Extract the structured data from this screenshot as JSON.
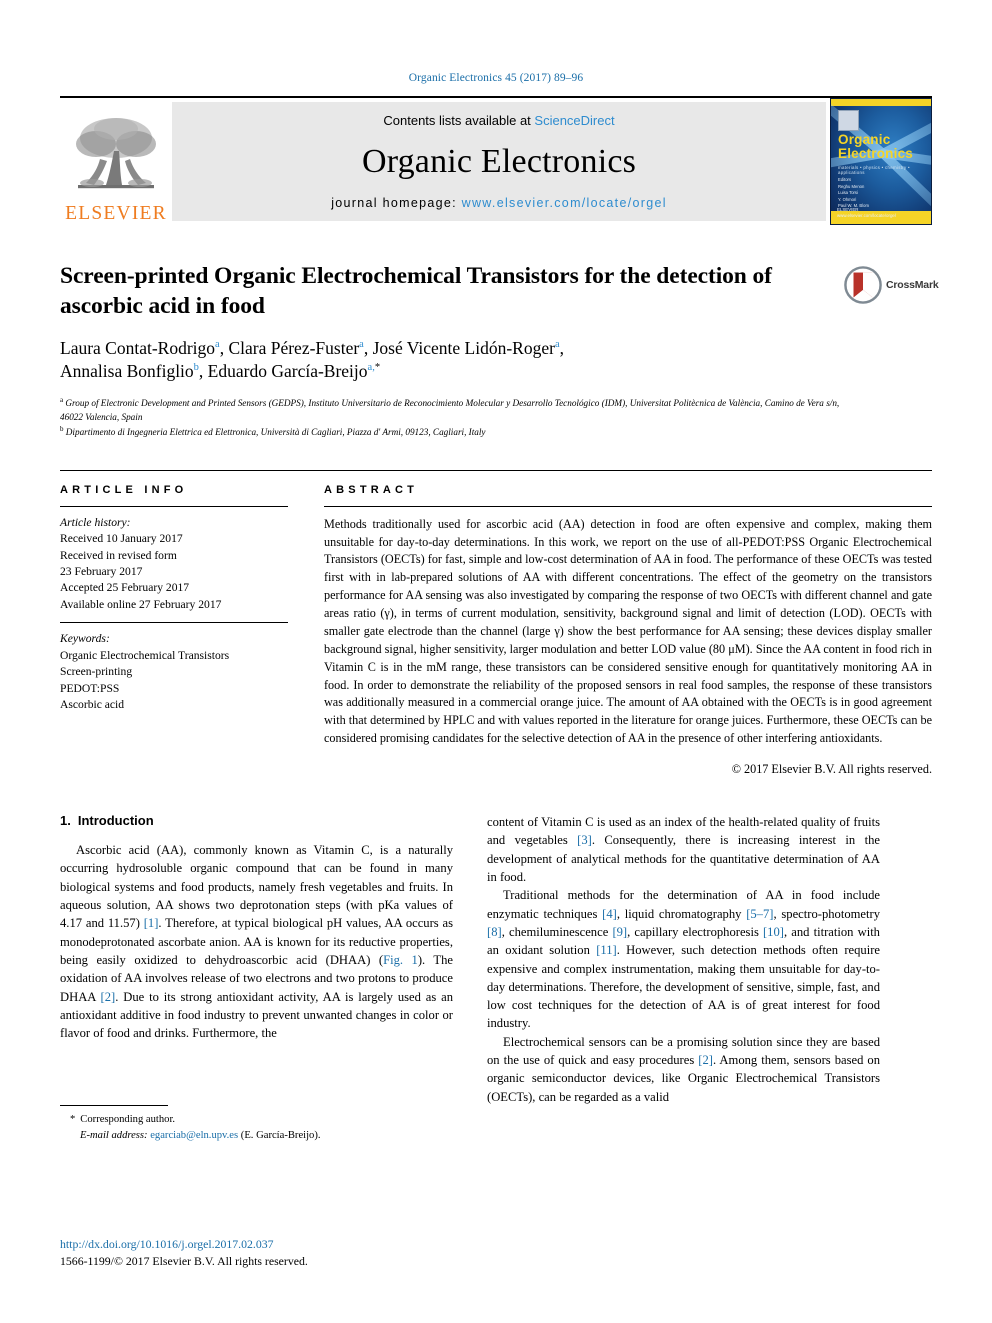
{
  "running_head": "Organic Electronics 45 (2017) 89–96",
  "masthead": {
    "publisher_logo_label": "ELSEVIER",
    "contents_prefix": "Contents lists available at ",
    "contents_link": "ScienceDirect",
    "journal_name": "Organic Electronics",
    "homepage_prefix": "journal homepage: ",
    "homepage_url": "www.elsevier.com/locate/orgel",
    "cover": {
      "title_line1": "Organic",
      "title_line2": "Electronics",
      "subtitle": "materials • physics • chemistry • applications",
      "editors_label": "Editors",
      "editors": "Reghu Menon\nLuisa Torsi\nY. Ohmori\nPaul W. M. Blom\nGeorg Heinz",
      "footer": "ELSEVIER\nwww.elsevier.com/locate/orgel"
    }
  },
  "article": {
    "title": "Screen-printed Organic Electrochemical Transistors for the detection of ascorbic acid in food",
    "authors_line1_parts": [
      {
        "name": "Laura Contat-Rodrigo",
        "sup": "a"
      },
      {
        "name": "Clara Pérez-Fuster",
        "sup": "a"
      },
      {
        "name": "José Vicente Lidón-Roger",
        "sup": "a"
      }
    ],
    "authors_line2_parts": [
      {
        "name": "Annalisa Bonfiglio",
        "sup": "b"
      },
      {
        "name": "Eduardo García-Breijo",
        "sup": "a,",
        "star": "*"
      }
    ],
    "affiliation_a_sup": "a",
    "affiliation_a": "Group of Electronic Development and Printed Sensors (GEDPS), Instituto Universitario de Reconocimiento Molecular y Desarrollo Tecnológico (IDM), Universitat Politècnica de València, Camino de Vera s/n, 46022 Valencia, Spain",
    "affiliation_b_sup": "b",
    "affiliation_b": "Dipartimento di Ingegneria Elettrica ed Elettronica, Università di Cagliari, Piazza d' Armi, 09123, Cagliari, Italy",
    "crossmark_label": "CrossMark"
  },
  "article_info": {
    "heading": "ARTICLE INFO",
    "history_label": "Article history:",
    "history": [
      "Received 10 January 2017",
      "Received in revised form",
      "23 February 2017",
      "Accepted 25 February 2017",
      "Available online 27 February 2017"
    ],
    "keywords_label": "Keywords:",
    "keywords": [
      "Organic Electrochemical Transistors",
      "Screen-printing",
      "PEDOT:PSS",
      "Ascorbic acid"
    ]
  },
  "abstract": {
    "heading": "ABSTRACT",
    "text": "Methods traditionally used for ascorbic acid (AA) detection in food are often expensive and complex, making them unsuitable for day-to-day determinations. In this work, we report on the use of all-PEDOT:PSS Organic Electrochemical Transistors (OECTs) for fast, simple and low-cost determination of AA in food. The performance of these OECTs was tested first with in lab-prepared solutions of AA with different concentrations. The effect of the geometry on the transistors performance for AA sensing was also investigated by comparing the response of two OECTs with different channel and gate areas ratio (γ), in terms of current modulation, sensitivity, background signal and limit of detection (LOD). OECTs with smaller gate electrode than the channel (large γ) show the best performance for AA sensing; these devices display smaller background signal, higher sensitivity, larger modulation and better LOD value (80 μM). Since the AA content in food rich in Vitamin C is in the mM range, these transistors can be considered sensitive enough for quantitatively monitoring AA in food. In order to demonstrate the reliability of the proposed sensors in real food samples, the response of these transistors was additionally measured in a commercial orange juice. The amount of AA obtained with the OECTs is in good agreement with that determined by HPLC and with values reported in the literature for orange juices. Furthermore, these OECTs can be considered promising candidates for the selective detection of AA in the presence of other interfering antioxidants.",
    "copyright": "© 2017 Elsevier B.V. All rights reserved."
  },
  "introduction": {
    "number": "1.",
    "heading": "Introduction",
    "left_p1_a": "Ascorbic acid (AA), commonly known as Vitamin C, is a naturally occurring hydrosoluble organic compound that can be found in many biological systems and food products, namely fresh vegetables and fruits. In aqueous solution, AA shows two deprotonation steps (with pKa values of 4.17 and 11.57) ",
    "left_p1_ref1": "[1]",
    "left_p1_b": ". Therefore, at typical biological pH values, AA occurs as monodeprotonated ascorbate anion. AA is known for its reductive properties, being easily oxidized to dehydroascorbic acid (DHAA) (",
    "left_p1_fig": "Fig. 1",
    "left_p1_c": "). The oxidation of AA involves release of two electrons and two protons to produce DHAA ",
    "left_p1_ref2": "[2]",
    "left_p1_d": ". Due to its strong antioxidant activity, AA is largely used as an antioxidant additive in food industry to prevent unwanted changes in color or flavor of food and drinks. Furthermore, the",
    "right_p1_a": "content of Vitamin C is used as an index of the health-related quality of fruits and vegetables ",
    "right_p1_ref3": "[3]",
    "right_p1_b": ". Consequently, there is increasing interest in the development of analytical methods for the quantitative determination of AA in food.",
    "right_p2_a": "Traditional methods for the determination of AA in food include enzymatic techniques ",
    "right_p2_ref4": "[4]",
    "right_p2_b": ", liquid chromatography ",
    "right_p2_ref57": "[5–7]",
    "right_p2_c": ", spectro-photometry ",
    "right_p2_ref8": "[8]",
    "right_p2_d": ", chemiluminescence ",
    "right_p2_ref9": "[9]",
    "right_p2_e": ", capillary electrophoresis ",
    "right_p2_ref10": "[10]",
    "right_p2_f": ", and titration with an oxidant solution ",
    "right_p2_ref11": "[11]",
    "right_p2_g": ". However, such detection methods often require expensive and complex instrumentation, making them unsuitable for day-to-day determinations. Therefore, the development of sensitive, simple, fast, and low cost techniques for the detection of AA is of great interest for food industry.",
    "right_p3_a": "Electrochemical sensors can be a promising solution since they are based on the use of quick and easy procedures ",
    "right_p3_ref2": "[2]",
    "right_p3_b": ". Among them, sensors based on organic semiconductor devices, like Organic Electrochemical Transistors (OECTs), can be regarded as a valid"
  },
  "footnote": {
    "star": "*",
    "corresponding": "Corresponding author.",
    "email_label": "E-mail address:",
    "email": "egarciab@eln.upv.es",
    "email_owner": "(E. García-Breijo)."
  },
  "page_footer": {
    "doi": "http://dx.doi.org/10.1016/j.orgel.2017.02.037",
    "issn_copyright": "1566-1199/© 2017 Elsevier B.V. All rights reserved."
  },
  "colors": {
    "link_blue": "#1a6ea8",
    "science_direct_blue": "#2e8ccf",
    "elsevier_orange": "#ef7c20",
    "crossmark_red": "#b8322a",
    "cover_yellow": "#f5d427"
  }
}
